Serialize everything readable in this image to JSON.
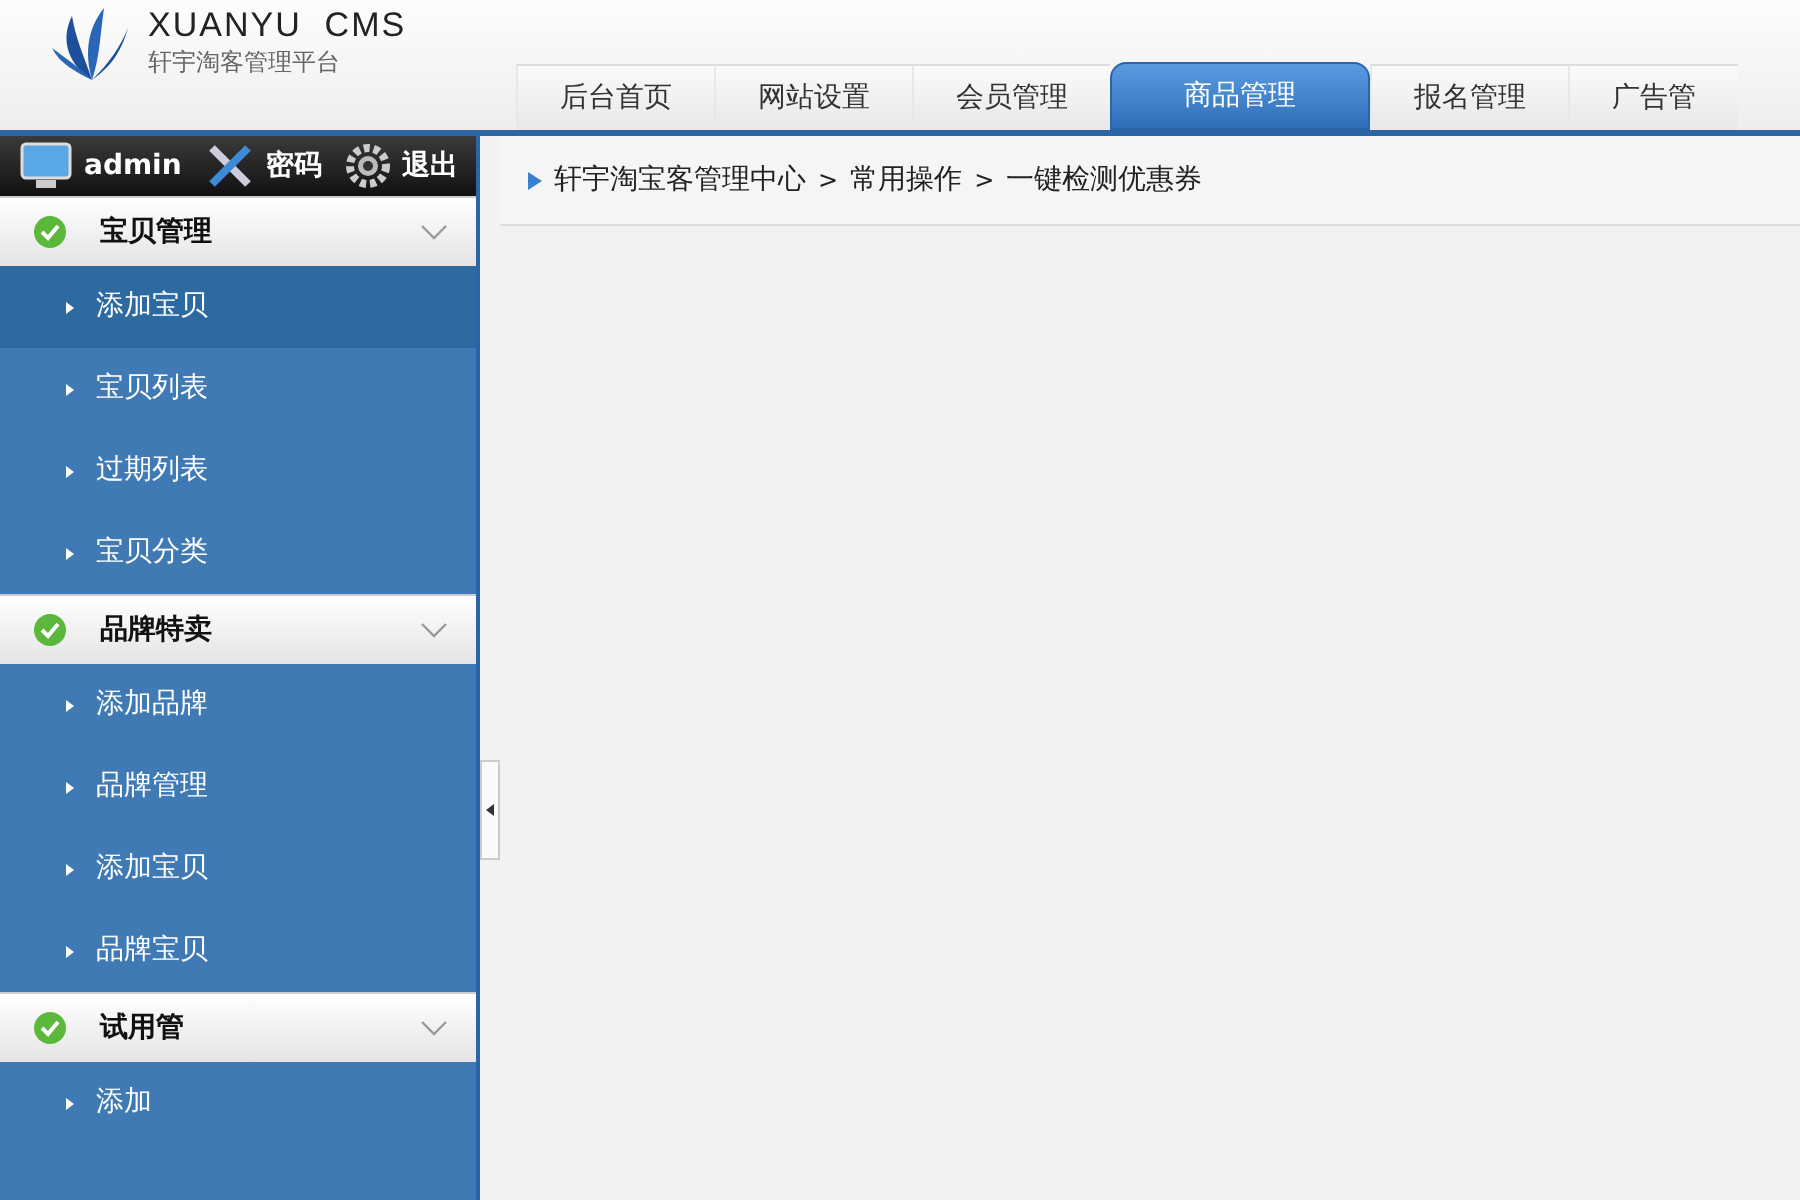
{
  "logo": {
    "title": "XUANYU  CMS",
    "subtitle": "轩宇淘客管理平台"
  },
  "tabs": [
    {
      "label": "后台首页",
      "selected": false
    },
    {
      "label": "网站设置",
      "selected": false
    },
    {
      "label": "会员管理",
      "selected": false
    },
    {
      "label": "商品管理",
      "selected": true
    },
    {
      "label": "报名管理",
      "selected": false
    },
    {
      "label": "广告管",
      "selected": false
    }
  ],
  "user_bar": {
    "user": "admin",
    "password": "密码",
    "logout": "退出"
  },
  "sidebar": {
    "groups": [
      {
        "label": "宝贝管理",
        "expanded": true,
        "items": [
          {
            "label": "添加宝贝",
            "selected": true
          },
          {
            "label": "宝贝列表",
            "selected": false
          },
          {
            "label": "过期列表",
            "selected": false
          },
          {
            "label": "宝贝分类",
            "selected": false
          }
        ]
      },
      {
        "label": "品牌特卖",
        "expanded": true,
        "items": [
          {
            "label": "添加品牌",
            "selected": false
          },
          {
            "label": "品牌管理",
            "selected": false
          },
          {
            "label": "添加宝贝",
            "selected": false
          },
          {
            "label": "品牌宝贝",
            "selected": false
          }
        ]
      },
      {
        "label": "试用管",
        "expanded": true,
        "items": [
          {
            "label": "添加",
            "selected": false
          }
        ]
      }
    ]
  },
  "breadcrumb": {
    "separator": ">",
    "items": [
      "轩宇淘宝客管理中心",
      "常用操作",
      "一键检测优惠券"
    ]
  }
}
